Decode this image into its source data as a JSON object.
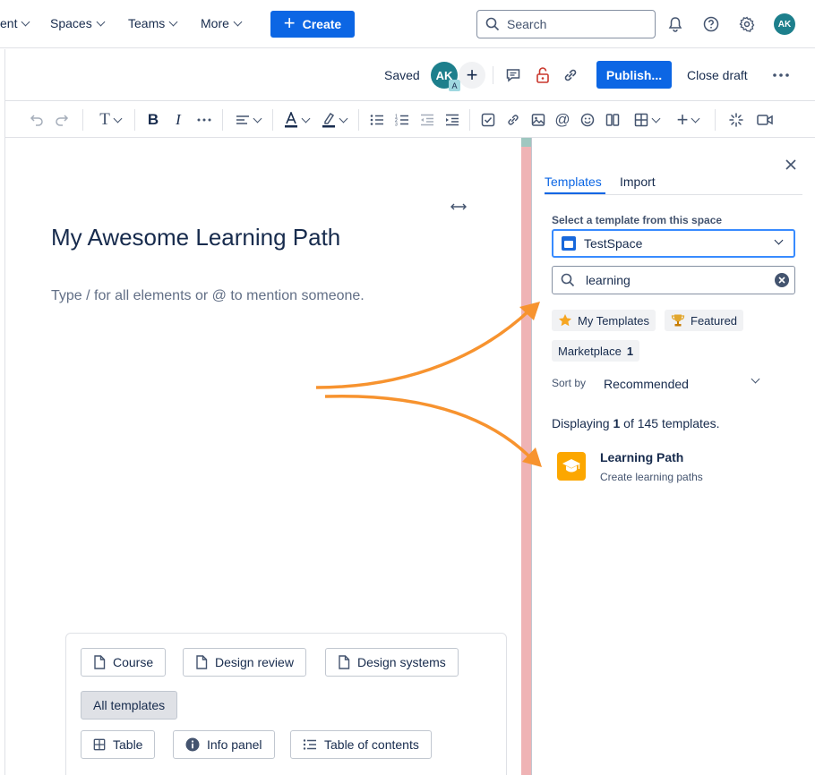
{
  "topnav": {
    "items": [
      "ent",
      "Spaces",
      "Teams",
      "More"
    ],
    "create_label": "Create",
    "search_placeholder": "Search",
    "avatar_initials": "AK"
  },
  "editor_header": {
    "saved_label": "Saved",
    "avatar_initials": "AK",
    "avatar_badge": "A",
    "publish_label": "Publish...",
    "close_draft_label": "Close draft"
  },
  "document": {
    "title": "My Awesome Learning Path",
    "placeholder": "Type / for all elements or @ to mention someone."
  },
  "suggestions": {
    "row1": [
      "Course",
      "Design review",
      "Design systems"
    ],
    "all_templates": "All templates",
    "row3": [
      "Table",
      "Info panel",
      "Table of contents"
    ]
  },
  "panel": {
    "tabs": [
      "Templates",
      "Import"
    ],
    "select_label": "Select a template from this space",
    "space_value": "TestSpace",
    "search_value": "learning",
    "filters": [
      {
        "label": "My Templates",
        "icon": "star-icon"
      },
      {
        "label": "Featured",
        "icon": "trophy-icon"
      }
    ],
    "marketplace_label": "Marketplace",
    "marketplace_count": "1",
    "sort_label": "Sort by",
    "sort_value": "Recommended",
    "display_prefix": "Displaying",
    "display_count": "1",
    "display_suffix": "of 145 templates.",
    "template_name": "Learning Path",
    "template_desc": "Create learning paths"
  },
  "colors": {
    "primary": "#0c66e4",
    "arrow": "#f7932f",
    "template_icon": "#fca700",
    "avatar": "#1d7f8c"
  }
}
